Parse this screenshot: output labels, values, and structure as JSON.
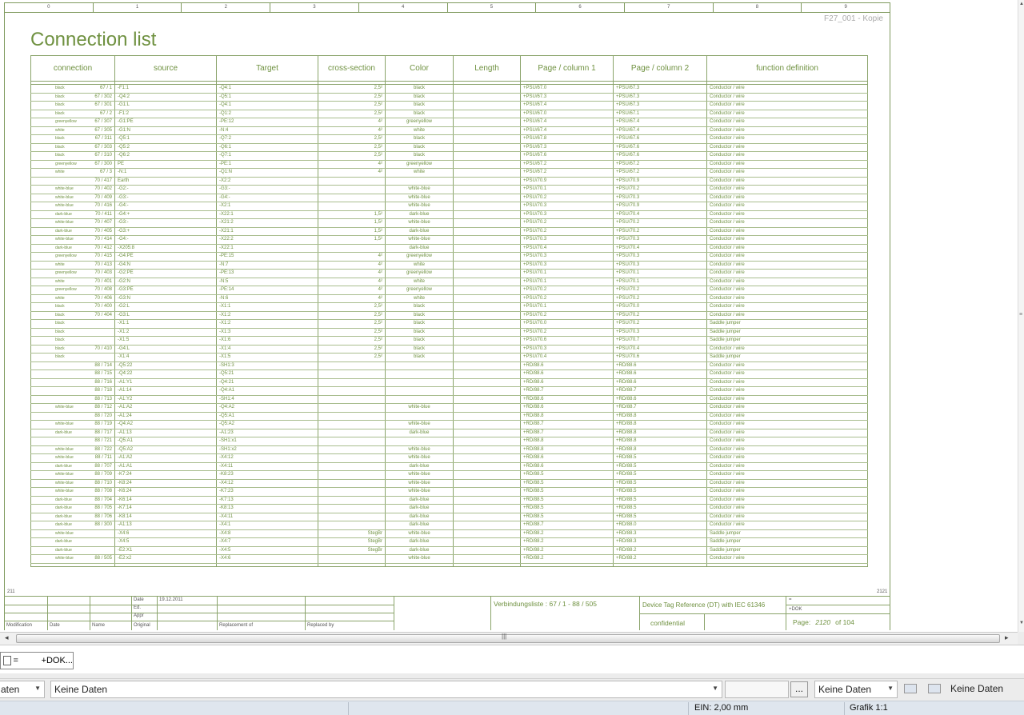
{
  "ruler": [
    "0",
    "1",
    "2",
    "3",
    "4",
    "5",
    "6",
    "7",
    "8",
    "9"
  ],
  "copy_label": "F27_001 - Kopie",
  "page_title": "Connection list",
  "table": {
    "headers": [
      "connection",
      "source",
      "Target",
      "cross-section",
      "Color",
      "Length",
      "Page / column 1",
      "Page / column 2",
      "function definition"
    ],
    "rows": [
      [
        "black",
        "67 / 1",
        "-F1:1",
        "-Q4:1",
        "2,5²",
        "black",
        "",
        "+PSU/67.0",
        "+PSU/67.3",
        "Conductor / wire"
      ],
      [
        "black",
        "67 / 302",
        "-Q4:2",
        "-Q5:1",
        "2,5²",
        "black",
        "",
        "+PSU/67.3",
        "+PSU/67.3",
        "Conductor / wire"
      ],
      [
        "black",
        "67 / 301",
        "-G1:L",
        "-Q4:1",
        "2,5²",
        "black",
        "",
        "+PSU/67.4",
        "+PSU/67.3",
        "Conductor / wire"
      ],
      [
        "black",
        "67 / 2",
        "-F1:2",
        "-Q1:2",
        "2,5²",
        "black",
        "",
        "+PSU/67.0",
        "+PSU/67.1",
        "Conductor / wire"
      ],
      [
        "greenyellow",
        "67 / 307",
        "-G1:PE",
        "-PE:12",
        "4²",
        "greenyellow",
        "",
        "+PSU/67.4",
        "+PSU/67.4",
        "Conductor / wire"
      ],
      [
        "white",
        "67 / 305",
        "-G1:N",
        "-N:4",
        "4²",
        "white",
        "",
        "+PSU/67.4",
        "+PSU/67.4",
        "Conductor / wire"
      ],
      [
        "black",
        "67 / 311",
        "-Q5:1",
        "-Q7:2",
        "2,5²",
        "black",
        "",
        "+PSU/67.8",
        "+PSU/67.6",
        "Conductor / wire"
      ],
      [
        "black",
        "67 / 303",
        "-Q5:2",
        "-Q6:1",
        "2,5²",
        "black",
        "",
        "+PSU/67.3",
        "+PSU/67.6",
        "Conductor / wire"
      ],
      [
        "black",
        "67 / 310",
        "-Q6:2",
        "-Q7:1",
        "2,5²",
        "black",
        "",
        "+PSU/67.6",
        "+PSU/67.6",
        "Conductor / wire"
      ],
      [
        "greenyellow",
        "67 / 300",
        "PE",
        "-PE:1",
        "4²",
        "greenyellow",
        "",
        "+PSU/67.2",
        "+PSU/67.2",
        "Conductor / wire"
      ],
      [
        "white",
        "67 / 3",
        "-N:1",
        "-Q1:N",
        "4²",
        "white",
        "",
        "+PSU/67.2",
        "+PSU/67.2",
        "Conductor / wire"
      ],
      [
        "",
        "70 / 417",
        "Earth",
        "-X2:2",
        "",
        "",
        "",
        "+PSU/70.9",
        "+PSU/70.9",
        "Conductor / wire"
      ],
      [
        "white-blue",
        "70 / 402",
        "-G2:-",
        "-G3:-",
        "",
        "white-blue",
        "",
        "+PSU/70.1",
        "+PSU/70.2",
        "Conductor / wire"
      ],
      [
        "white-blue",
        "70 / 409",
        "-G3:-",
        "-G4:-",
        "",
        "white-blue",
        "",
        "+PSU/70.2",
        "+PSU/70.3",
        "Conductor / wire"
      ],
      [
        "white-blue",
        "70 / 416",
        "-G4:-",
        "-X2:1",
        "",
        "white-blue",
        "",
        "+PSU/70.3",
        "+PSU/70.9",
        "Conductor / wire"
      ],
      [
        "dark-blue",
        "70 / 411",
        "-G4:+",
        "-X22:1",
        "1,5²",
        "dark-blue",
        "",
        "+PSU/70.3",
        "+PSU/70.4",
        "Conductor / wire"
      ],
      [
        "white-blue",
        "70 / 407",
        "-G3:-",
        "-X21:2",
        "1,5²",
        "white-blue",
        "",
        "+PSU/70.2",
        "+PSU/70.2",
        "Conductor / wire"
      ],
      [
        "dark-blue",
        "70 / 405",
        "-G3:+",
        "-X21:1",
        "1,5²",
        "dark-blue",
        "",
        "+PSU/70.2",
        "+PSU/70.2",
        "Conductor / wire"
      ],
      [
        "white-blue",
        "70 / 414",
        "-G4:-",
        "-X22:2",
        "1,5²",
        "white-blue",
        "",
        "+PSU/70.3",
        "+PSU/70.3",
        "Conductor / wire"
      ],
      [
        "dark-blue",
        "70 / 412",
        "-X205:8",
        "-X22:1",
        "",
        "dark-blue",
        "",
        "+PSU/70.4",
        "+PSU/70.4",
        "Conductor / wire"
      ],
      [
        "greenyellow",
        "70 / 415",
        "-G4:PE",
        "-PE:15",
        "4²",
        "greenyellow",
        "",
        "+PSU/70.3",
        "+PSU/70.3",
        "Conductor / wire"
      ],
      [
        "white",
        "70 / 413",
        "-G4:N",
        "-N:7",
        "4²",
        "white",
        "",
        "+PSU/70.3",
        "+PSU/70.3",
        "Conductor / wire"
      ],
      [
        "greenyellow",
        "70 / 403",
        "-G2:PE",
        "-PE:13",
        "4²",
        "greenyellow",
        "",
        "+PSU/70.1",
        "+PSU/70.1",
        "Conductor / wire"
      ],
      [
        "white",
        "70 / 401",
        "-G2:N",
        "-N:5",
        "4²",
        "white",
        "",
        "+PSU/70.1",
        "+PSU/70.1",
        "Conductor / wire"
      ],
      [
        "greenyellow",
        "70 / 408",
        "-G3:PE",
        "-PE:14",
        "4²",
        "greenyellow",
        "",
        "+PSU/70.2",
        "+PSU/70.2",
        "Conductor / wire"
      ],
      [
        "white",
        "70 / 406",
        "-G3:N",
        "-N:6",
        "4²",
        "white",
        "",
        "+PSU/70.2",
        "+PSU/70.2",
        "Conductor / wire"
      ],
      [
        "black",
        "70 / 400",
        "-G2:L",
        "-X1:1",
        "2,5²",
        "black",
        "",
        "+PSU/70.1",
        "+PSU/70.0",
        "Conductor / wire"
      ],
      [
        "black",
        "70 / 404",
        "-G3:L",
        "-X1:2",
        "2,5²",
        "black",
        "",
        "+PSU/70.2",
        "+PSU/70.2",
        "Conductor / wire"
      ],
      [
        "black",
        "",
        "-X1:1",
        "-X1:2",
        "2,5²",
        "black",
        "",
        "+PSU/70.0",
        "+PSU/70.2",
        "Saddle jumper"
      ],
      [
        "black",
        "",
        "-X1:2",
        "-X1:3",
        "2,5²",
        "black",
        "",
        "+PSU/70.2",
        "+PSU/70.3",
        "Saddle jumper"
      ],
      [
        "black",
        "",
        "-X1:5",
        "-X1:6",
        "2,5²",
        "black",
        "",
        "+PSU/70.6",
        "+PSU/70.7",
        "Saddle jumper"
      ],
      [
        "black",
        "70 / 410",
        "-G4:L",
        "-X1:4",
        "2,5²",
        "black",
        "",
        "+PSU/70.3",
        "+PSU/70.4",
        "Conductor / wire"
      ],
      [
        "black",
        "",
        "-X1:4",
        "-X1:5",
        "2,5²",
        "black",
        "",
        "+PSU/70.4",
        "+PSU/70.6",
        "Saddle jumper"
      ],
      [
        "",
        "88 / 714",
        "-Q5:22",
        "-SH1:3",
        "",
        "",
        "",
        "+RD/88.6",
        "+RD/88.6",
        "Conductor / wire"
      ],
      [
        "",
        "88 / 715",
        "-Q4:22",
        "-Q5:21",
        "",
        "",
        "",
        "+RD/88.6",
        "+RD/88.6",
        "Conductor / wire"
      ],
      [
        "",
        "88 / 716",
        "-A1:Y1",
        "-Q4:21",
        "",
        "",
        "",
        "+RD/88.6",
        "+RD/88.6",
        "Conductor / wire"
      ],
      [
        "",
        "88 / 718",
        "-A1:14",
        "-Q4:A1",
        "",
        "",
        "",
        "+RD/88.7",
        "+RD/88.7",
        "Conductor / wire"
      ],
      [
        "",
        "88 / 713",
        "-A1:Y2",
        "-SH1:4",
        "",
        "",
        "",
        "+RD/88.6",
        "+RD/88.6",
        "Conductor / wire"
      ],
      [
        "white-blue",
        "88 / 712",
        "-A1:A2",
        "-Q4:A2",
        "",
        "white-blue",
        "",
        "+RD/88.6",
        "+RD/88.7",
        "Conductor / wire"
      ],
      [
        "",
        "88 / 720",
        "-A1:24",
        "-Q5:A1",
        "",
        "",
        "",
        "+RD/88.8",
        "+RD/88.8",
        "Conductor / wire"
      ],
      [
        "white-blue",
        "88 / 719",
        "-Q4:A2",
        "-Q5:A2",
        "",
        "white-blue",
        "",
        "+RD/88.7",
        "+RD/88.8",
        "Conductor / wire"
      ],
      [
        "dark-blue",
        "88 / 717",
        "-A1:13",
        "-A1:23",
        "",
        "dark-blue",
        "",
        "+RD/88.7",
        "+RD/88.8",
        "Conductor / wire"
      ],
      [
        "",
        "88 / 721",
        "-Q5:A1",
        "-SH1:x1",
        "",
        "",
        "",
        "+RD/88.8",
        "+RD/88.8",
        "Conductor / wire"
      ],
      [
        "white-blue",
        "88 / 722",
        "-Q5:A2",
        "-SH1:x2",
        "",
        "white-blue",
        "",
        "+RD/88.8",
        "+RD/88.8",
        "Conductor / wire"
      ],
      [
        "white-blue",
        "88 / 711",
        "-A1:A2",
        "-X4:12",
        "",
        "white-blue",
        "",
        "+RD/88.6",
        "+RD/88.5",
        "Conductor / wire"
      ],
      [
        "dark-blue",
        "88 / 707",
        "-A1:A1",
        "-X4:11",
        "",
        "dark-blue",
        "",
        "+RD/88.6",
        "+RD/88.5",
        "Conductor / wire"
      ],
      [
        "white-blue",
        "88 / 709",
        "-K7:24",
        "-K8:23",
        "",
        "white-blue",
        "",
        "+RD/88.5",
        "+RD/88.5",
        "Conductor / wire"
      ],
      [
        "white-blue",
        "88 / 710",
        "-K8:24",
        "-X4:12",
        "",
        "white-blue",
        "",
        "+RD/88.5",
        "+RD/88.5",
        "Conductor / wire"
      ],
      [
        "white-blue",
        "88 / 708",
        "-K6:24",
        "-K7:23",
        "",
        "white-blue",
        "",
        "+RD/88.5",
        "+RD/88.5",
        "Conductor / wire"
      ],
      [
        "dark-blue",
        "88 / 704",
        "-K6:14",
        "-K7:13",
        "",
        "dark-blue",
        "",
        "+RD/88.5",
        "+RD/88.5",
        "Conductor / wire"
      ],
      [
        "dark-blue",
        "88 / 705",
        "-K7:14",
        "-K8:13",
        "",
        "dark-blue",
        "",
        "+RD/88.5",
        "+RD/88.5",
        "Conductor / wire"
      ],
      [
        "dark-blue",
        "88 / 706",
        "-K8:14",
        "-X4:11",
        "",
        "dark-blue",
        "",
        "+RD/88.5",
        "+RD/88.5",
        "Conductor / wire"
      ],
      [
        "dark-blue",
        "88 / 300",
        "-A1:13",
        "-X4:1",
        "",
        "dark-blue",
        "",
        "+RD/88.7",
        "+RD/88.0",
        "Conductor / wire"
      ],
      [
        "white-blue",
        "",
        "-X4:6",
        "-X4:8",
        "StegBr",
        "white-blue",
        "",
        "+RD/88.2",
        "+RD/88.3",
        "Saddle jumper"
      ],
      [
        "dark-blue",
        "",
        "-X4:5",
        "-X4:7",
        "StegBr",
        "dark-blue",
        "",
        "+RD/88.2",
        "+RD/88.3",
        "Saddle jumper"
      ],
      [
        "dark-blue",
        "",
        "-E2:X1",
        "-X4:5",
        "StegBr",
        "dark-blue",
        "",
        "+RD/88.2",
        "+RD/88.2",
        "Saddle jumper"
      ],
      [
        "white-blue",
        "88 / 505",
        "-E2:x2",
        "-X4:6",
        "",
        "white-blue",
        "",
        "+RD/88.2",
        "+RD/88.2",
        "Conductor / wire"
      ]
    ]
  },
  "page_left": "211",
  "page_right": "2121",
  "title_block": {
    "date_label": "Date",
    "date_value": "19.12.2011",
    "ed_label": "Ed.",
    "appr_label": "Appr",
    "original_label": "Original",
    "modification_label": "Modification",
    "date_col_label": "Date",
    "name_label": "Name",
    "replacement_label": "Replacement of",
    "replaced_label": "Replaced by",
    "list_ref": "Verbindungsliste : 67 / 1 - 88 / 505",
    "dt_ref": "Device Tag Reference (DT) with IEC 61346",
    "confidential": "confidential",
    "eq_sign": "=",
    "dok_sign": "+DOK",
    "page_label": "Page:",
    "page_number": "2120",
    "of_label": "of",
    "page_total": "104"
  },
  "tab": {
    "eq": "=",
    "label": "+DOK..."
  },
  "toolbar": {
    "combo_a": "aten",
    "combo_b": "Keine Daten",
    "dots": "...",
    "combo_d": "Keine Daten",
    "right_text": "Keine Daten"
  },
  "statusbar": {
    "ein": "EIN: 2,00 mm",
    "grafik": "Grafik 1:1"
  }
}
